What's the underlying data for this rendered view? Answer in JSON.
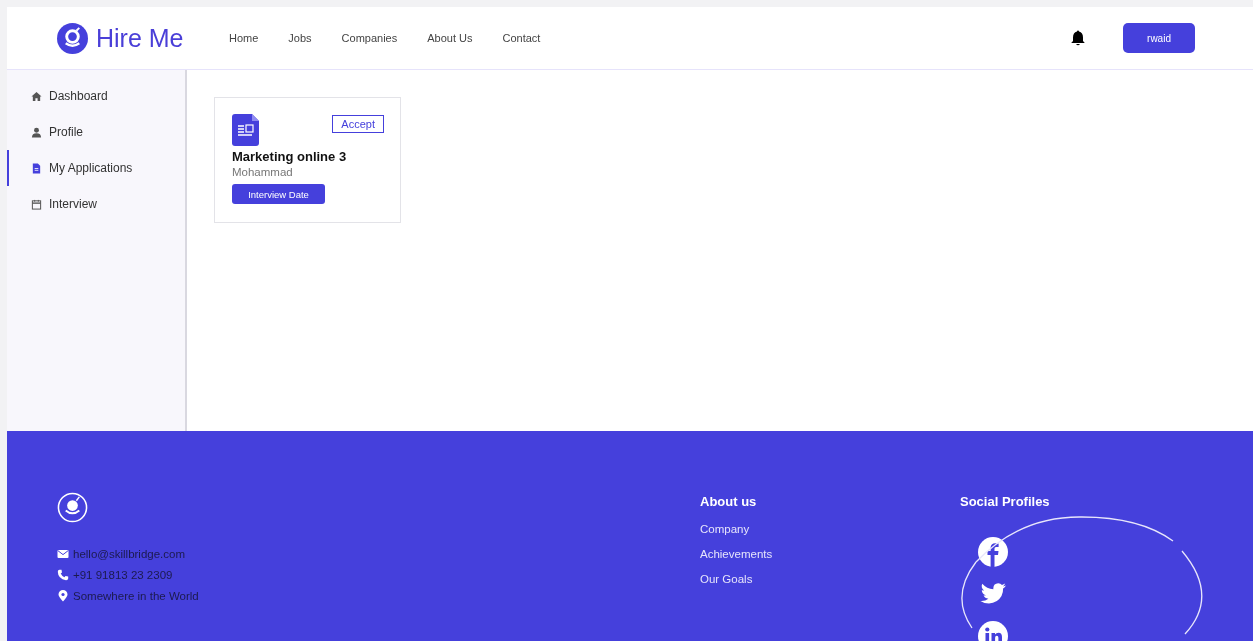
{
  "header": {
    "logo": "Hire Me",
    "nav": [
      "Home",
      "Jobs",
      "Companies",
      "About Us",
      "Contact"
    ],
    "user_button": "rwaid"
  },
  "sidebar": {
    "items": [
      {
        "label": "Dashboard",
        "kind": "home",
        "selected": false
      },
      {
        "label": "Profile",
        "kind": "user",
        "selected": false
      },
      {
        "label": "My Applications",
        "kind": "file",
        "selected": true
      },
      {
        "label": "Interview",
        "kind": "calendar",
        "selected": false
      }
    ]
  },
  "applications": [
    {
      "title": "Marketing online 3",
      "company": "Mohammad",
      "status": "Accept",
      "action": "Interview Date"
    }
  ],
  "footer": {
    "contacts": [
      {
        "kind": "email",
        "text": "hello@skillbridge.com"
      },
      {
        "kind": "phone",
        "text": "+91 91813 23 2309"
      },
      {
        "kind": "location",
        "text": "Somewhere in the World"
      }
    ],
    "about": {
      "heading": "About us",
      "links": [
        "Company",
        "Achievements",
        "Our Goals"
      ]
    },
    "social": {
      "heading": "Social Profiles",
      "profiles": [
        {
          "kind": "facebook"
        },
        {
          "kind": "twitter"
        },
        {
          "kind": "linkedin"
        }
      ]
    }
  }
}
